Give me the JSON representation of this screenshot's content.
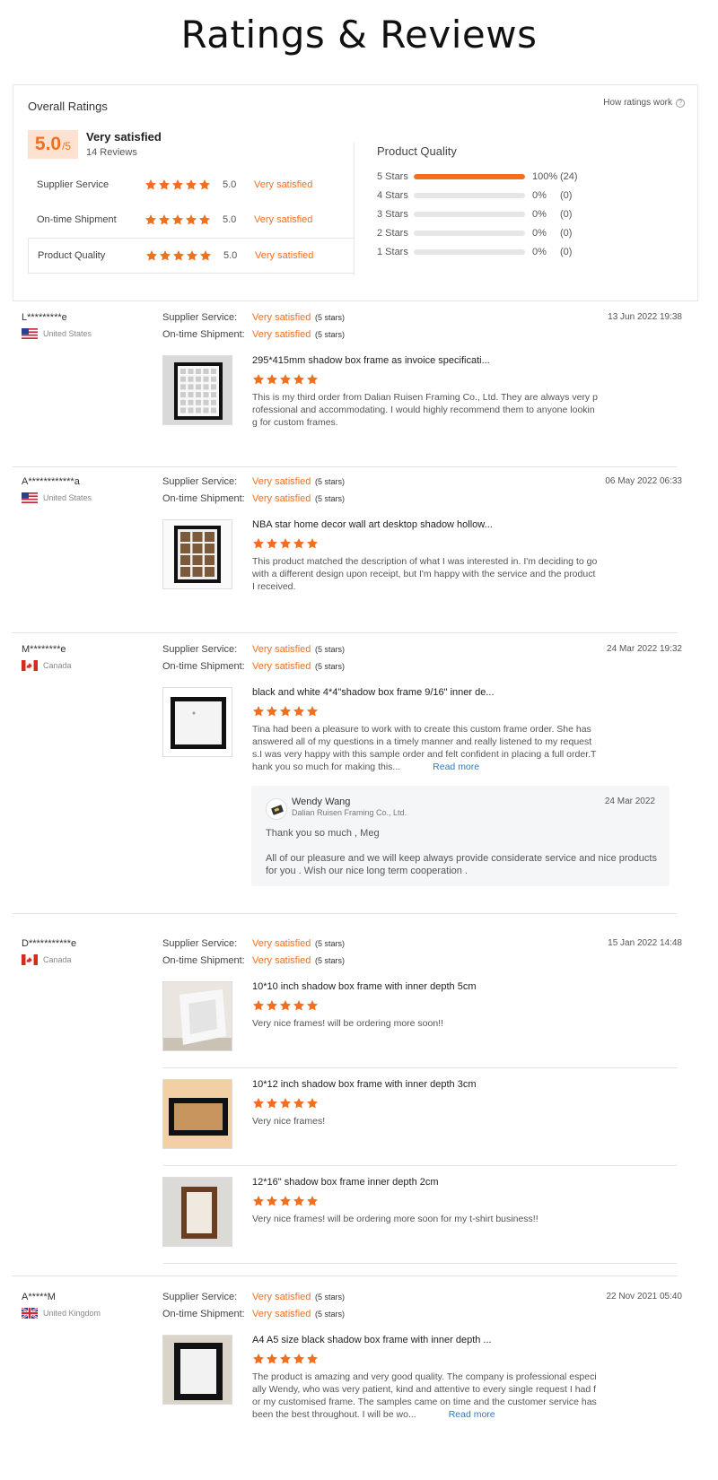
{
  "page_title": "Ratings & Reviews",
  "colors": {
    "accent": "#f36f20",
    "link": "#2e77d0"
  },
  "summary": {
    "title": "Overall Ratings",
    "how_link": "How ratings work",
    "score": "5.0",
    "score_denominator": "/5",
    "score_label": "Very satisfied",
    "review_count": "14 Reviews",
    "rows": [
      {
        "name": "Supplier Service",
        "value": "5.0",
        "desc": "Very satisfied",
        "stars": 5
      },
      {
        "name": "On-time Shipment",
        "value": "5.0",
        "desc": "Very satisfied",
        "stars": 5
      },
      {
        "name": "Product Quality",
        "value": "5.0",
        "desc": "Very satisfied",
        "stars": 5
      }
    ],
    "quality_title": "Product Quality",
    "distribution": [
      {
        "label": "5 Stars",
        "fraction": 1.0,
        "pct": "100%",
        "count": "(24)"
      },
      {
        "label": "4 Stars",
        "fraction": 0,
        "pct": "0%",
        "count": "(0)"
      },
      {
        "label": "3 Stars",
        "fraction": 0,
        "pct": "0%",
        "count": "(0)"
      },
      {
        "label": "2 Stars",
        "fraction": 0,
        "pct": "0%",
        "count": "(0)"
      },
      {
        "label": "1 Stars",
        "fraction": 0,
        "pct": "0%",
        "count": "(0)"
      }
    ]
  },
  "meta_labels": {
    "supplier": "Supplier Service:",
    "shipment": "On-time Shipment:",
    "value": "Very satisfied",
    "stars": "(5 stars)",
    "read_more": "Read more"
  },
  "reviews": [
    {
      "user": "L*********e",
      "country": "United States",
      "flag": "us-flag-icon",
      "date": "13 Jun 2022 19:38",
      "items": [
        {
          "title": "295*415mm shadow box frame as invoice specificati...",
          "stars": 5,
          "text": "This is my third order from Dalian Ruisen Framing Co., Ltd. They are always very professional and accommodating. I would highly recommend them to anyone looking for custom frames."
        }
      ]
    },
    {
      "user": "A************a",
      "country": "United States",
      "flag": "us-flag-icon",
      "date": "06 May 2022 06:33",
      "items": [
        {
          "title": "NBA star home decor wall art desktop shadow hollow...",
          "stars": 5,
          "text": "This product matched the description of what I was interested in. I'm deciding to go with a different design upon receipt, but I'm happy with the service and the product I received."
        }
      ]
    },
    {
      "user": "M********e",
      "country": "Canada",
      "flag": "canada-flag-icon",
      "date": "24 Mar 2022 19:32",
      "items": [
        {
          "title": "black and white 4*4\"shadow box frame 9/16\" inner de...",
          "stars": 5,
          "text": "Tina had been a pleasure to work with to create this custom frame order. She has answered all of my questions in a timely manner and really listened to my requests.I was very happy with this sample order and felt confident in placing a full order.Thank you so much for making this..."
        }
      ],
      "reply": {
        "name": "Wendy Wang",
        "company": "Dalian Ruisen Framing Co., Ltd.",
        "date": "24 Mar 2022",
        "line1": "Thank you so much , Meg",
        "line2": "All of our pleasure and we will keep always provide considerate service and nice products for you . Wish our nice long term cooperation ."
      }
    },
    {
      "user": "D***********e",
      "country": "Canada",
      "flag": "canada-flag-icon",
      "date": "15 Jan 2022 14:48",
      "items": [
        {
          "title": "10*10 inch shadow box frame with inner depth 5cm",
          "stars": 5,
          "text": "Very nice frames! will be ordering more soon!!"
        },
        {
          "title": "10*12 inch shadow box frame with inner depth 3cm",
          "stars": 5,
          "text": "Very nice frames!"
        },
        {
          "title": "12*16\" shadow box frame inner depth 2cm",
          "stars": 5,
          "text": "Very nice frames! will be ordering more soon for my t-shirt business!!"
        }
      ]
    },
    {
      "user": "A*****M",
      "country": "United Kingdom",
      "flag": "uk-flag-icon",
      "date": "22 Nov 2021 05:40",
      "items": [
        {
          "title": "A4 A5 size black shadow box frame with inner depth ...",
          "stars": 5,
          "text": "The product is amazing and very good quality. The company is professional especially Wendy, who was very patient, kind and attentive to every single request I had for my customised frame. The samples came on time and the customer service has been the best throughout. I will be wo..."
        }
      ]
    }
  ]
}
